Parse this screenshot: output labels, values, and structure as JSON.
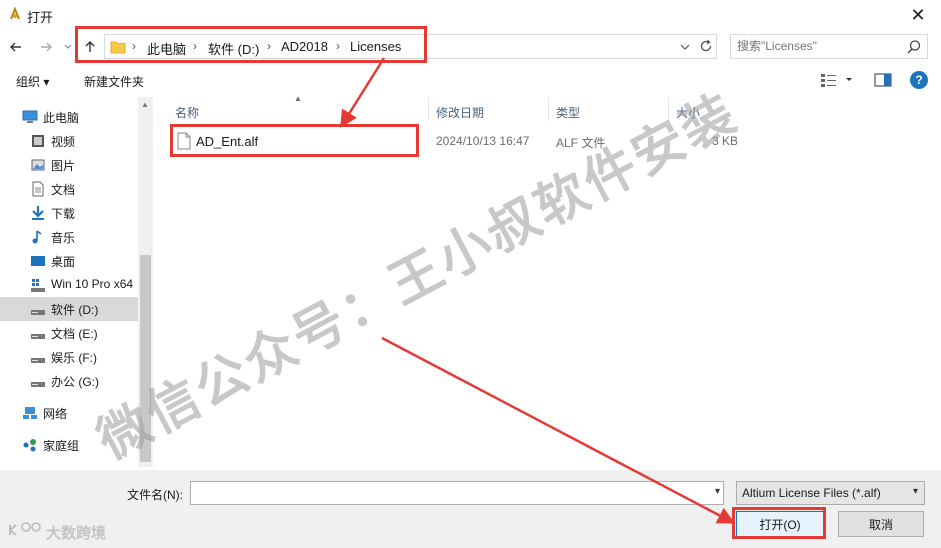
{
  "window": {
    "title": "打开",
    "close_glyph": "✕"
  },
  "address": {
    "crumbs": [
      "此电脑",
      "软件 (D:)",
      "AD2018",
      "Licenses"
    ]
  },
  "search": {
    "placeholder": "搜索\"Licenses\""
  },
  "toolbar": {
    "organize_label": "组织 ▾",
    "new_folder_label": "新建文件夹"
  },
  "sidebar": {
    "items": [
      {
        "label": "此电脑",
        "icon": "pc-icon"
      },
      {
        "label": "视频",
        "icon": "video-icon"
      },
      {
        "label": "图片",
        "icon": "picture-icon"
      },
      {
        "label": "文档",
        "icon": "document-icon"
      },
      {
        "label": "下载",
        "icon": "download-icon"
      },
      {
        "label": "音乐",
        "icon": "music-icon"
      },
      {
        "label": "桌面",
        "icon": "desktop-icon"
      },
      {
        "label": "Win 10 Pro x64",
        "icon": "system-drive-icon"
      },
      {
        "label": "软件 (D:)",
        "icon": "drive-icon"
      },
      {
        "label": "文档 (E:)",
        "icon": "drive-icon"
      },
      {
        "label": "娱乐 (F:)",
        "icon": "drive-icon"
      },
      {
        "label": "办公 (G:)",
        "icon": "drive-icon"
      },
      {
        "label": "网络",
        "icon": "network-icon"
      },
      {
        "label": "家庭组",
        "icon": "homegroup-icon"
      }
    ],
    "selected_index": 8
  },
  "columns": {
    "name": "名称",
    "date": "修改日期",
    "type": "类型",
    "size": "大小"
  },
  "files": [
    {
      "name": "AD_Ent.alf",
      "date": "2024/10/13 16:47",
      "type": "ALF 文件",
      "size": "3 KB"
    }
  ],
  "bottom": {
    "filename_label": "文件名(N):",
    "filename_value": "",
    "filter_label": "Altium License Files (*.alf)",
    "open_label": "打开(O)",
    "cancel_label": "取消"
  },
  "watermark": {
    "text": "微信公众号：王小叔软件安装"
  },
  "corner_logo": {
    "text": "大数跨境"
  },
  "colors": {
    "annotation_red": "#e53935",
    "accent_blue": "#0078d7",
    "folder_yellow": "#f7c948"
  }
}
